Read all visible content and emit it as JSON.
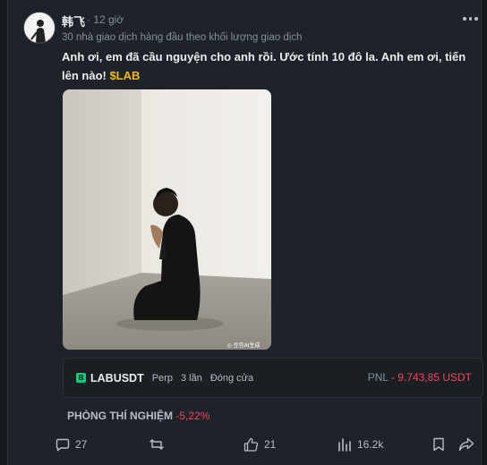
{
  "post": {
    "author": "韩飞",
    "time": "· 12 giờ",
    "subline": "30 nhà giao dịch hàng đầu theo khối lượng giao dịch",
    "text": "Anh ơi, em đã cầu nguyện cho anh rồi. Ước tính 10 đô la. Anh em ơi, tiến lên nào! ",
    "ticker": "$LAB"
  },
  "image": {
    "icon": "person-praying-photo",
    "watermark": "◎ 豆包AI生成"
  },
  "trade": {
    "badge": "B",
    "pair": "LABUSDT",
    "type": "Perp",
    "times": "3 lần",
    "status": "Đóng cửa",
    "pnl_label": "PNL",
    "pnl_value": "- 9.743,85 USDT"
  },
  "lab": {
    "label": "PHÒNG THÍ NGHIỆM",
    "change": "-5,22%"
  },
  "actions": {
    "comments": "27",
    "likes": "21",
    "views": "16.2k"
  },
  "colors": {
    "accent": "#f0b90b",
    "negative": "#f6465d",
    "positive": "#0ecb81"
  }
}
